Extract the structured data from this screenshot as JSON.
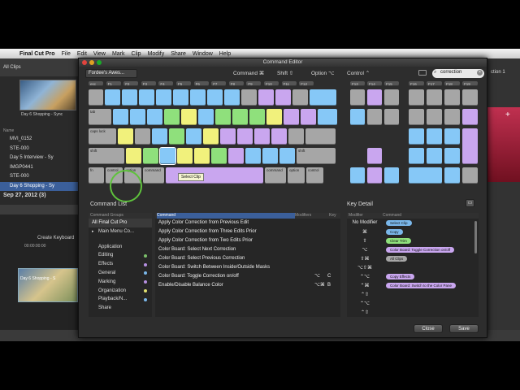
{
  "menubar": {
    "apple": "",
    "app": "Final Cut Pro",
    "items": [
      "File",
      "Edit",
      "View",
      "Mark",
      "Clip",
      "Modify",
      "Share",
      "Window",
      "Help"
    ]
  },
  "background": {
    "library_header": "All Clips",
    "thumb_label": "Day 6 Shopping - Sync",
    "tree_header": "Name",
    "tree": [
      {
        "label": "MVI_0152"
      },
      {
        "label": "STE-000"
      },
      {
        "label": "Day 5 Interview - Sy"
      },
      {
        "label": "IMGP0441"
      },
      {
        "label": "STE-000"
      },
      {
        "label": "Day 6 Shopping - Sy"
      }
    ],
    "date_row": "Sep 27, 2012  (3)",
    "timeline_label": "Create Keyboard",
    "timeline_time": "00:00:00:00",
    "timeline_clip": "Day 6 Shopping - S",
    "right_value": "ction 1"
  },
  "dialog": {
    "title": "Command Editor",
    "set_name": "Fordee's Awes...",
    "modifiers": [
      {
        "label": "Command ⌘"
      },
      {
        "label": "Shift ⇧"
      },
      {
        "label": "Option ⌥"
      },
      {
        "label": "Control ⌃"
      }
    ],
    "search_value": "correction",
    "tooltip": "Select Clip",
    "keyboard": {
      "main_fn": [
        "esc",
        "F1",
        "F2",
        "F3",
        "F4",
        "F5",
        "F6",
        "F7",
        "F8",
        "F9",
        "F10",
        "F11",
        "F12"
      ],
      "row1": [
        {
          "c": "gray",
          "t": ""
        },
        {
          "c": "blue",
          "t": ""
        },
        {
          "c": "blue",
          "t": ""
        },
        {
          "c": "blue",
          "t": ""
        },
        {
          "c": "blue",
          "t": ""
        },
        {
          "c": "blue",
          "t": ""
        },
        {
          "c": "blue",
          "t": ""
        },
        {
          "c": "blue",
          "t": ""
        },
        {
          "c": "blue",
          "t": ""
        },
        {
          "c": "gray",
          "t": ""
        },
        {
          "c": "purple",
          "t": ""
        },
        {
          "c": "purple",
          "t": ""
        },
        {
          "c": "gray",
          "t": ""
        },
        {
          "c": "blue",
          "t": ""
        }
      ],
      "row2": [
        {
          "c": "gray",
          "t": "tab"
        },
        {
          "c": "blue",
          "t": ""
        },
        {
          "c": "blue",
          "t": ""
        },
        {
          "c": "blue",
          "t": ""
        },
        {
          "c": "green",
          "t": ""
        },
        {
          "c": "yellow",
          "t": ""
        },
        {
          "c": "blue",
          "t": ""
        },
        {
          "c": "green",
          "t": ""
        },
        {
          "c": "green",
          "t": ""
        },
        {
          "c": "green",
          "t": ""
        },
        {
          "c": "yellow",
          "t": ""
        },
        {
          "c": "purple",
          "t": ""
        },
        {
          "c": "purple",
          "t": ""
        },
        {
          "c": "blue",
          "t": ""
        }
      ],
      "row3": [
        {
          "c": "gray",
          "t": "caps lock"
        },
        {
          "c": "yellow",
          "t": ""
        },
        {
          "c": "gray",
          "t": ""
        },
        {
          "c": "blue",
          "t": ""
        },
        {
          "c": "green",
          "t": ""
        },
        {
          "c": "blue",
          "t": ""
        },
        {
          "c": "yellow",
          "t": ""
        },
        {
          "c": "purple",
          "t": ""
        },
        {
          "c": "purple",
          "t": ""
        },
        {
          "c": "purple",
          "t": ""
        },
        {
          "c": "purple",
          "t": ""
        },
        {
          "c": "gray",
          "t": ""
        },
        {
          "c": "gray",
          "t": ""
        }
      ],
      "row4": [
        {
          "c": "gray",
          "t": "shift"
        },
        {
          "c": "yellow",
          "t": ""
        },
        {
          "c": "green",
          "t": ""
        },
        {
          "c": "blue",
          "t": "",
          "sel": true
        },
        {
          "c": "yellow",
          "t": ""
        },
        {
          "c": "yellow",
          "t": ""
        },
        {
          "c": "green",
          "t": ""
        },
        {
          "c": "purple",
          "t": ""
        },
        {
          "c": "blue",
          "t": ""
        },
        {
          "c": "blue",
          "t": ""
        },
        {
          "c": "blue",
          "t": ""
        },
        {
          "c": "gray",
          "t": "shift"
        }
      ],
      "row5": [
        {
          "c": "gray",
          "t": "fn"
        },
        {
          "c": "gray",
          "t": "control"
        },
        {
          "c": "gray",
          "t": "option"
        },
        {
          "c": "gray",
          "t": "command"
        },
        {
          "c": "purple",
          "t": ""
        },
        {
          "c": "gray",
          "t": "command"
        },
        {
          "c": "gray",
          "t": "option"
        },
        {
          "c": "gray",
          "t": "control"
        }
      ],
      "nav_fn": [
        "F13",
        "F14",
        "F15"
      ],
      "nav_keys": [
        {
          "c": "gray",
          "t": ""
        },
        {
          "c": "purple",
          "t": ""
        },
        {
          "c": "gray",
          "t": ""
        },
        {
          "c": "blue",
          "t": ""
        },
        {
          "c": "gray",
          "t": ""
        },
        {
          "c": "gray",
          "t": ""
        },
        {
          "c": "purple",
          "t": ""
        },
        {
          "c": "blue",
          "t": ""
        },
        {
          "c": "purple",
          "t": ""
        },
        {
          "c": "blue",
          "t": ""
        }
      ],
      "pad_fn": [
        "F16",
        "F17",
        "F18",
        "F19"
      ],
      "pad_keys": [
        {
          "c": "gray",
          "t": ""
        },
        {
          "c": "gray",
          "t": ""
        },
        {
          "c": "gray",
          "t": ""
        },
        {
          "c": "gray",
          "t": ""
        },
        {
          "c": "gray",
          "t": ""
        },
        {
          "c": "gray",
          "t": ""
        },
        {
          "c": "gray",
          "t": ""
        },
        {
          "c": "purple",
          "t": ""
        },
        {
          "c": "blue",
          "t": ""
        },
        {
          "c": "blue",
          "t": ""
        },
        {
          "c": "blue",
          "t": ""
        },
        {
          "c": "purple",
          "t": ""
        },
        {
          "c": "blue",
          "t": ""
        },
        {
          "c": "blue",
          "t": ""
        },
        {
          "c": "blue",
          "t": ""
        },
        {
          "c": "gray",
          "t": ""
        },
        {
          "c": "blue",
          "t": ""
        },
        {
          "c": "blue",
          "t": ""
        },
        {
          "c": "gray",
          "t": ""
        }
      ]
    },
    "command_list": {
      "title": "Command List",
      "groups_header": "Command Groups",
      "groups_top": [
        {
          "label": "All Final Cut Pro",
          "sel": true
        },
        {
          "label": "Main Menu Co...",
          "caret": true
        }
      ],
      "groups": [
        {
          "label": "Application",
          "dot": ""
        },
        {
          "label": "Editing",
          "dot": "#7bbf6a"
        },
        {
          "label": "Effects",
          "dot": "#b58fe0"
        },
        {
          "label": "General",
          "dot": "#7ab7ea"
        },
        {
          "label": "Marking",
          "dot": "#b58fe0"
        },
        {
          "label": "Organization",
          "dot": "#e0e070"
        },
        {
          "label": "Playback/N...",
          "dot": "#7ab7ea"
        },
        {
          "label": "Share",
          "dot": ""
        }
      ],
      "cmd_header": "Command",
      "mod_header": "Modifiers",
      "key_header": "Key",
      "commands": [
        {
          "label": "Apply Color Correction from Previous Edit",
          "mod": "",
          "key": ""
        },
        {
          "label": "Apply Color Correction from Three Edits Prior",
          "mod": "",
          "key": ""
        },
        {
          "label": "Apply Color Correction from Two Edits Prior",
          "mod": "",
          "key": ""
        },
        {
          "label": "Color Board: Select Next Correction",
          "mod": "",
          "key": ""
        },
        {
          "label": "Color Board: Select Previous Correction",
          "mod": "",
          "key": ""
        },
        {
          "label": "Color Board: Switch Between Inside/Outside Masks",
          "mod": "",
          "key": ""
        },
        {
          "label": "Color Board: Toggle Correction on/off",
          "mod": "⌥",
          "key": "C"
        },
        {
          "label": "Enable/Disable Balance Color",
          "mod": "⌥⌘",
          "key": "B"
        }
      ]
    },
    "key_detail": {
      "title": "Key Detail",
      "modifier_header": "Modifier",
      "command_header": "Command",
      "rows": [
        {
          "mod": "No Modifier",
          "cmd": "Select Clip",
          "color": "#7ab7ea"
        },
        {
          "mod": "⌘",
          "cmd": "Copy",
          "color": "#7ab7ea"
        },
        {
          "mod": "⇧",
          "cmd": "Clear Trim",
          "color": "#8fe07c"
        },
        {
          "mod": "⌥",
          "cmd": "Color Board: Toggle Correction on/off",
          "color": "#c9a6ef"
        },
        {
          "mod": "⇧⌘",
          "cmd": "All Clips",
          "color": "#a6a6a6"
        },
        {
          "mod": "⌥⇧⌘",
          "cmd": "",
          "color": ""
        },
        {
          "mod": "⌃⌥",
          "cmd": "Copy Effects",
          "color": "#c9a6ef"
        },
        {
          "mod": "⌃⌘",
          "cmd": "Color Board: Switch to the Color Pane",
          "color": "#c9a6ef"
        },
        {
          "mod": "⌃⇧",
          "cmd": "",
          "color": ""
        },
        {
          "mod": "⌃⌥",
          "cmd": "",
          "color": ""
        },
        {
          "mod": "⌃⇧",
          "cmd": "",
          "color": ""
        }
      ]
    },
    "close_label": "Close",
    "save_label": "Save"
  }
}
